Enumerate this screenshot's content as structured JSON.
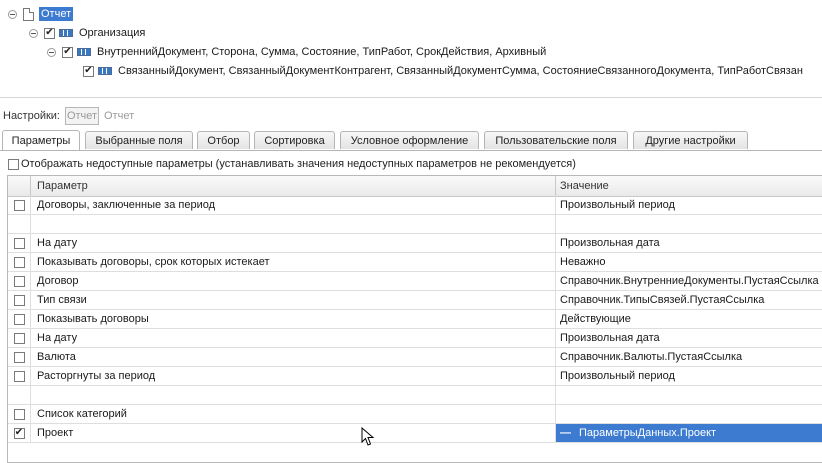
{
  "tree": {
    "root": {
      "label": "Отчет",
      "checked": false
    },
    "org": {
      "label": "Организация",
      "checked": true
    },
    "group1": {
      "label": "ВнутреннийДокумент, Сторона, Сумма, Состояние, ТипРабот, СрокДействия, Архивный",
      "checked": true
    },
    "group2": {
      "label": "СвязанныйДокумент, СвязанныйДокументКонтрагент, СвязанныйДокументСумма, СостояниеСвязанногоДокумента, ТипРаботСвязан",
      "checked": true
    }
  },
  "settings": {
    "label": "Настройки:",
    "box_value": "Отчет",
    "value": "Отчет"
  },
  "tabs": [
    {
      "label": "Параметры",
      "active": true
    },
    {
      "label": "Выбранные поля"
    },
    {
      "label": "Отбор"
    },
    {
      "label": "Сортировка"
    },
    {
      "label": "Условное оформление"
    },
    {
      "label": "Пользовательские поля"
    },
    {
      "label": "Другие настройки"
    }
  ],
  "show_unavailable": {
    "label": "Отображать недоступные параметры (устанавливать значения недоступных параметров не рекомендуется)",
    "checked": false
  },
  "grid": {
    "col_param": "Параметр",
    "col_value": "Значение",
    "rows": [
      {
        "check": "",
        "param": "Договоры, заключенные за период",
        "value": "Произвольный период"
      },
      {
        "check": null,
        "param": "",
        "value": ""
      },
      {
        "check": "",
        "param": "На дату",
        "value": "Произвольная дата"
      },
      {
        "check": "",
        "param": "Показывать договоры, срок которых истекает",
        "value": "Неважно"
      },
      {
        "check": "",
        "param": "Договор",
        "value": "Справочник.ВнутренниеДокументы.ПустаяСсылка"
      },
      {
        "check": "",
        "param": "Тип связи",
        "value": "Справочник.ТипыСвязей.ПустаяСсылка"
      },
      {
        "check": "",
        "param": "Показывать договоры",
        "value": "Действующие"
      },
      {
        "check": "",
        "param": "На дату",
        "value": "Произвольная дата"
      },
      {
        "check": "",
        "param": "Валюта",
        "value": "Справочник.Валюты.ПустаяСсылка"
      },
      {
        "check": "",
        "param": "Расторгнуты за период",
        "value": "Произвольный период"
      },
      {
        "check": null,
        "param": "",
        "value": ""
      },
      {
        "check": "",
        "param": "Список категорий",
        "value": ""
      },
      {
        "check": "✔",
        "param": "Проект",
        "value": "ПараметрыДанных.Проект",
        "selected": true,
        "dash": "—"
      }
    ]
  },
  "colors": {
    "selection": "#3d7bd1"
  }
}
